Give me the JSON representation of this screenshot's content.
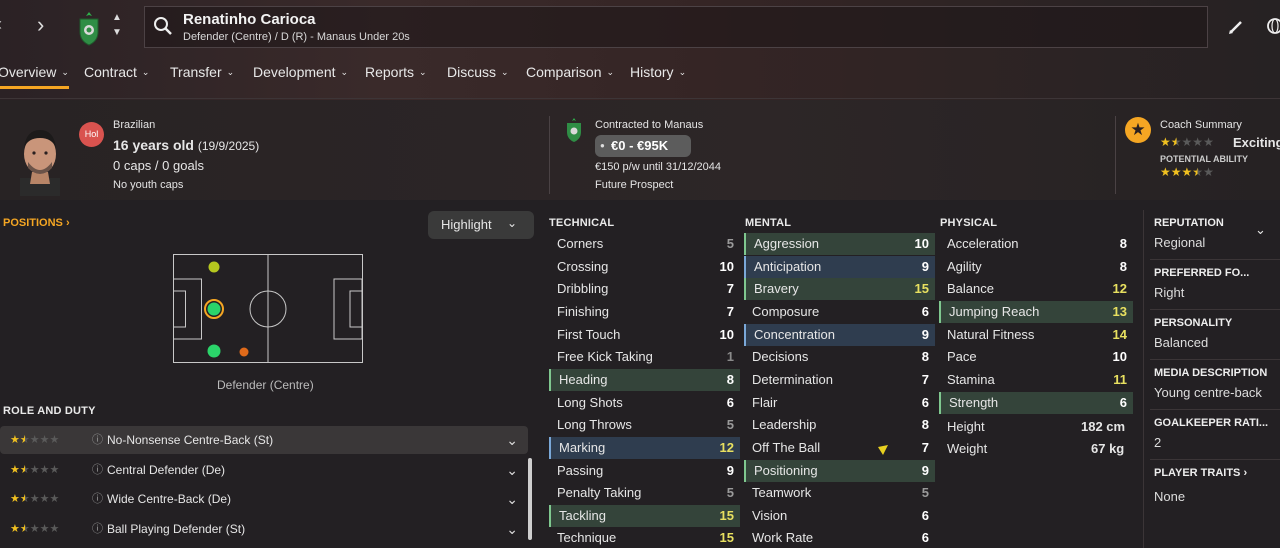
{
  "header": {
    "player_name": "Renatinho Carioca",
    "subtitle": "Defender (Centre) / D (R) - Manaus Under 20s",
    "back_icon": "chevron-left-icon",
    "forward_icon": "chevron-right-icon",
    "search_icon": "search-icon",
    "edit_icon": "pencil-icon",
    "globe_icon": "globe-icon"
  },
  "tabs": [
    {
      "label": "Overview"
    },
    {
      "label": "Contract"
    },
    {
      "label": "Transfer"
    },
    {
      "label": "Development"
    },
    {
      "label": "Reports"
    },
    {
      "label": "Discuss"
    },
    {
      "label": "Comparison"
    },
    {
      "label": "History"
    }
  ],
  "info": {
    "position_badge": "Hol",
    "nationality": "Brazilian",
    "age": "16 years old",
    "dob": "(19/9/2025)",
    "caps": "0 caps / 0 goals",
    "youth_caps": "No youth caps",
    "contract_label": "Contracted to Manaus",
    "value_range": "€0 - €95K",
    "wage": "€150 p/w until 31/12/2044",
    "prospect": "Future Prospect",
    "coach_summary_label": "Coach Summary",
    "coach_summary_value": "Exciting",
    "potential_label": "POTENTIAL ABILITY",
    "current_ability_stars": 1.5,
    "potential_ability_stars": 3.5
  },
  "positions": {
    "title": "POSITIONS",
    "highlight_label": "Highlight",
    "position_name": "Defender (Centre)"
  },
  "roles": {
    "title": "ROLE AND DUTY",
    "items": [
      {
        "name": "No-Nonsense Centre-Back (St)",
        "stars": 1.5
      },
      {
        "name": "Central Defender (De)",
        "stars": 1.5
      },
      {
        "name": "Wide Centre-Back (De)",
        "stars": 1.5
      },
      {
        "name": "Ball Playing Defender (St)",
        "stars": 1.5
      }
    ]
  },
  "technical": {
    "title": "TECHNICAL",
    "rows": [
      {
        "name": "Corners",
        "value": "5",
        "hl": "",
        "color": "#9a9a9a"
      },
      {
        "name": "Crossing",
        "value": "10",
        "hl": "",
        "color": "#ffffff"
      },
      {
        "name": "Dribbling",
        "value": "7",
        "hl": "",
        "color": "#ffffff"
      },
      {
        "name": "Finishing",
        "value": "7",
        "hl": "",
        "color": "#ffffff"
      },
      {
        "name": "First Touch",
        "value": "10",
        "hl": "",
        "color": "#ffffff"
      },
      {
        "name": "Free Kick Taking",
        "value": "1",
        "hl": "",
        "color": "#8a8a8a"
      },
      {
        "name": "Heading",
        "value": "8",
        "hl": "green",
        "color": "#ffffff"
      },
      {
        "name": "Long Shots",
        "value": "6",
        "hl": "",
        "color": "#ffffff"
      },
      {
        "name": "Long Throws",
        "value": "5",
        "hl": "",
        "color": "#9a9a9a"
      },
      {
        "name": "Marking",
        "value": "12",
        "hl": "blue",
        "color": "#e8e060"
      },
      {
        "name": "Passing",
        "value": "9",
        "hl": "",
        "color": "#ffffff"
      },
      {
        "name": "Penalty Taking",
        "value": "5",
        "hl": "",
        "color": "#9a9a9a"
      },
      {
        "name": "Tackling",
        "value": "15",
        "hl": "green",
        "color": "#e8e060"
      },
      {
        "name": "Technique",
        "value": "15",
        "hl": "",
        "color": "#e8e060"
      }
    ]
  },
  "mental": {
    "title": "MENTAL",
    "rows": [
      {
        "name": "Aggression",
        "value": "10",
        "hl": "green",
        "color": "#ffffff"
      },
      {
        "name": "Anticipation",
        "value": "9",
        "hl": "blue",
        "color": "#ffffff"
      },
      {
        "name": "Bravery",
        "value": "15",
        "hl": "green",
        "color": "#e8e060"
      },
      {
        "name": "Composure",
        "value": "6",
        "hl": "",
        "color": "#ffffff"
      },
      {
        "name": "Concentration",
        "value": "9",
        "hl": "blue",
        "color": "#ffffff"
      },
      {
        "name": "Decisions",
        "value": "8",
        "hl": "",
        "color": "#ffffff"
      },
      {
        "name": "Determination",
        "value": "7",
        "hl": "",
        "color": "#ffffff"
      },
      {
        "name": "Flair",
        "value": "6",
        "hl": "",
        "color": "#ffffff"
      },
      {
        "name": "Leadership",
        "value": "8",
        "hl": "",
        "color": "#ffffff"
      },
      {
        "name": "Off The Ball",
        "value": "7",
        "hl": "",
        "color": "#ffffff"
      },
      {
        "name": "Positioning",
        "value": "9",
        "hl": "green",
        "color": "#ffffff"
      },
      {
        "name": "Teamwork",
        "value": "5",
        "hl": "",
        "color": "#9a9a9a"
      },
      {
        "name": "Vision",
        "value": "6",
        "hl": "",
        "color": "#ffffff"
      },
      {
        "name": "Work Rate",
        "value": "6",
        "hl": "",
        "color": "#ffffff"
      }
    ]
  },
  "physical": {
    "title": "PHYSICAL",
    "rows": [
      {
        "name": "Acceleration",
        "value": "8",
        "hl": "",
        "color": "#ffffff"
      },
      {
        "name": "Agility",
        "value": "8",
        "hl": "",
        "color": "#ffffff"
      },
      {
        "name": "Balance",
        "value": "12",
        "hl": "",
        "color": "#e8e060"
      },
      {
        "name": "Jumping Reach",
        "value": "13",
        "hl": "green",
        "color": "#e8e060"
      },
      {
        "name": "Natural Fitness",
        "value": "14",
        "hl": "",
        "color": "#e8e060"
      },
      {
        "name": "Pace",
        "value": "10",
        "hl": "",
        "color": "#ffffff"
      },
      {
        "name": "Stamina",
        "value": "11",
        "hl": "",
        "color": "#e8e060"
      },
      {
        "name": "Strength",
        "value": "6",
        "hl": "green",
        "color": "#ffffff"
      }
    ],
    "height_label": "Height",
    "height_value": "182 cm",
    "weight_label": "Weight",
    "weight_value": "67 kg"
  },
  "sidebar": {
    "reputation_label": "REPUTATION",
    "reputation_value": "Regional",
    "foot_label": "PREFERRED FO...",
    "foot_value": "Right",
    "personality_label": "PERSONALITY",
    "personality_value": "Balanced",
    "media_label": "MEDIA DESCRIPTION",
    "media_value": "Young centre-back",
    "gk_label": "GOALKEEPER RATI...",
    "gk_value": "2",
    "traits_label": "PLAYER TRAITS",
    "traits_value": "None"
  },
  "colors": {
    "accent": "#f5a623",
    "good_value": "#e8e060",
    "key_attr_green": "#34443a",
    "key_attr_blue": "#2f3d4f"
  }
}
